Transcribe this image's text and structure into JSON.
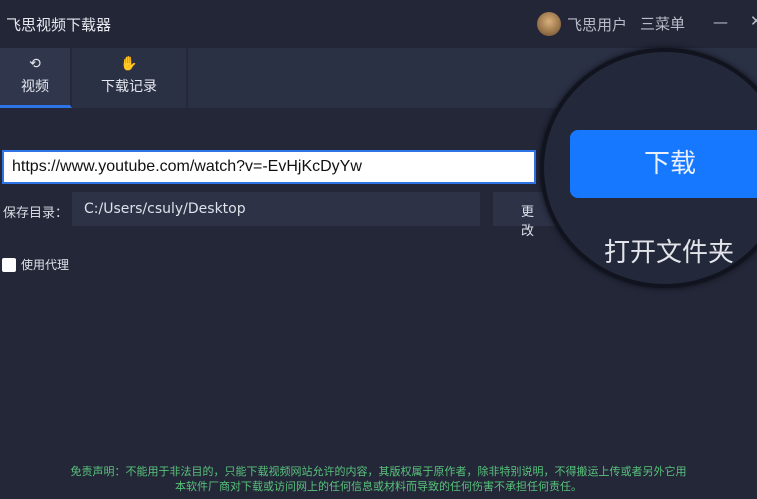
{
  "app": {
    "title": "飞思视频下载器",
    "user": "飞思用户",
    "menu": "三菜单",
    "minimize": "—",
    "close": "✕"
  },
  "tabs": [
    {
      "label": "视频",
      "icon": "video-convert-icon",
      "active": true
    },
    {
      "label": "下载记录",
      "icon": "hand-history-icon",
      "active": false
    }
  ],
  "url_input": {
    "value": "https://www.youtube.com/watch?v=-EvHjKcDyYw"
  },
  "save": {
    "label": "保存目录：",
    "path": "C:/Users/csuly/Desktop",
    "change": "更改"
  },
  "proxy": {
    "label": "使用代理",
    "checked": false
  },
  "buttons": {
    "download": "下载",
    "open_folder": "打开文件夹"
  },
  "footer": {
    "line1": "免责声明：不能用于非法目的，只能下载视频网站允许的内容，其版权属于原作者，除非特别说明，不得搬运上传或者另外它用",
    "line2": "本软件厂商对下载或访问网上的任何信息或材料而导致的任何伤害不承担任何责任。"
  },
  "colors": {
    "accent": "#1677ff",
    "footer": "#58c27a"
  }
}
